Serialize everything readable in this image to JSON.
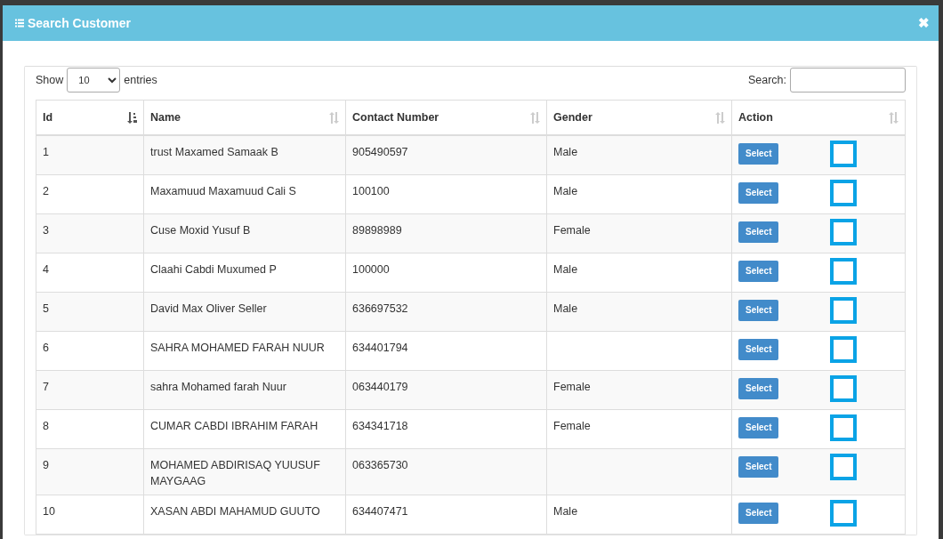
{
  "modal": {
    "title": "Search Customer",
    "close_label": "✖"
  },
  "controls": {
    "show_label": "Show",
    "page_size": "10",
    "entries_label": "entries",
    "search_label": "Search:"
  },
  "table": {
    "columns": [
      {
        "label": "Id",
        "sorted": true
      },
      {
        "label": "Name",
        "sorted": false
      },
      {
        "label": "Contact Number",
        "sorted": false
      },
      {
        "label": "Gender",
        "sorted": false
      },
      {
        "label": "Action",
        "sorted": false
      }
    ],
    "rows": [
      {
        "id": "1",
        "name": "trust Maxamed Samaak B",
        "contact": "905490597",
        "gender": "Male",
        "button": "Select",
        "checked": false
      },
      {
        "id": "2",
        "name": "Maxamuud Maxamuud Cali S",
        "contact": "100100",
        "gender": "Male",
        "button": "Select",
        "checked": false
      },
      {
        "id": "3",
        "name": "Cuse Moxid Yusuf B",
        "contact": "89898989",
        "gender": "Female",
        "button": "Select",
        "checked": false
      },
      {
        "id": "4",
        "name": "Claahi Cabdi Muxumed P",
        "contact": "100000",
        "gender": "Male",
        "button": "Select",
        "checked": false
      },
      {
        "id": "5",
        "name": "David Max Oliver Seller",
        "contact": "636697532",
        "gender": "Male",
        "button": "Select",
        "checked": false
      },
      {
        "id": "6",
        "name": "SAHRA MOHAMED FARAH NUUR",
        "contact": "634401794",
        "button": "Select",
        "checked": false
      },
      {
        "id": "7",
        "name": "sahra Mohamed farah Nuur",
        "contact": "063440179",
        "gender": "Female",
        "button": "Select",
        "checked": false
      },
      {
        "id": "8",
        "name": "CUMAR CABDI IBRAHIM FARAH",
        "contact": "634341718",
        "gender": "Female",
        "button": "Select",
        "checked": false
      },
      {
        "id": "9",
        "name": "MOHAMED ABDIRISAQ YUUSUF MAYGAAG",
        "contact": "063365730",
        "button": "Select",
        "checked": false
      },
      {
        "id": "10",
        "name": "XASAN ABDI MAHAMUD GUUTO",
        "contact": "634407471",
        "gender": "Male",
        "button": "Select",
        "checked": false
      }
    ]
  }
}
